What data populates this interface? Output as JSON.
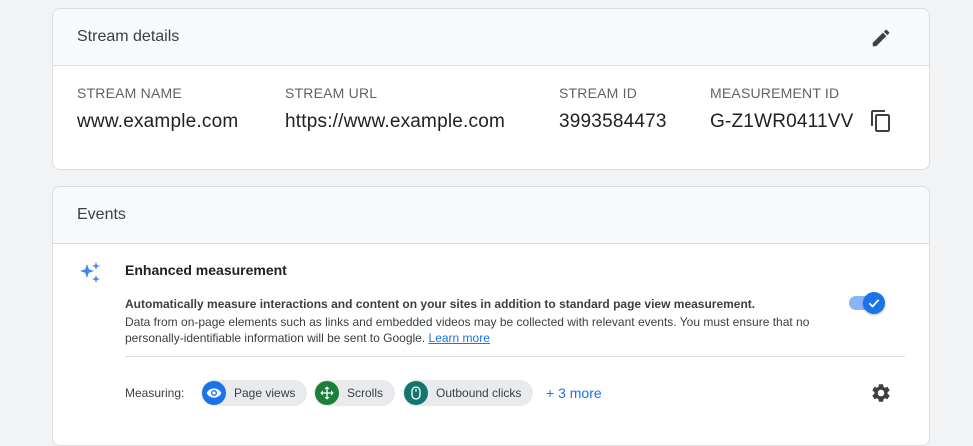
{
  "stream_card": {
    "title": "Stream details",
    "fields": [
      {
        "label": "STREAM NAME",
        "value": "www.example.com"
      },
      {
        "label": "STREAM URL",
        "value": "https://www.example.com"
      },
      {
        "label": "STREAM ID",
        "value": "3993584473"
      },
      {
        "label": "MEASUREMENT ID",
        "value": "G-Z1WR0411VV"
      }
    ],
    "icons": {
      "edit": "pencil-icon",
      "copy": "copy-icon"
    }
  },
  "events_card": {
    "title": "Events",
    "enhanced": {
      "icon": "sparkle-icon",
      "title": "Enhanced measurement",
      "desc_bold": "Automatically measure interactions and content on your sites in addition to standard page view measurement.",
      "desc": "Data from on-page elements such as links and embedded videos may be collected with relevant events. You must ensure that no personally-identifiable information will be sent to Google.",
      "learn_more": "Learn more",
      "enabled": true
    },
    "measuring": {
      "label": "Measuring:",
      "chips": [
        {
          "label": "Page views",
          "icon": "eye-icon",
          "color": "#1a73e8"
        },
        {
          "label": "Scrolls",
          "icon": "scroll-arrows-icon",
          "color": "#188038"
        },
        {
          "label": "Outbound clicks",
          "icon": "mouse-icon",
          "color": "#12766e"
        }
      ],
      "more": "+ 3 more",
      "settings_icon": "gear-icon"
    }
  },
  "colors": {
    "accent": "#1a73e8",
    "toggle_track": "#8ab4f8",
    "header_bg": "#f8f9fa",
    "border": "#dadce0"
  }
}
